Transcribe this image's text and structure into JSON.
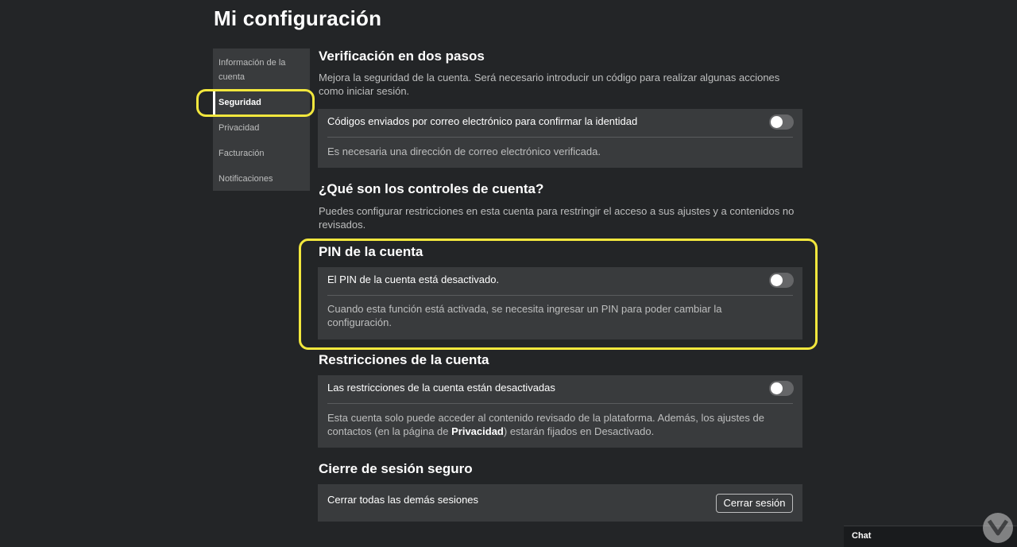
{
  "page": {
    "title": "Mi configuración"
  },
  "sidebar": {
    "items": [
      {
        "label": "Información de la cuenta",
        "active": false
      },
      {
        "label": "Seguridad",
        "active": true
      },
      {
        "label": "Privacidad",
        "active": false
      },
      {
        "label": "Facturación",
        "active": false
      },
      {
        "label": "Notificaciones",
        "active": false
      }
    ]
  },
  "two_step": {
    "title": "Verificación en dos pasos",
    "description": "Mejora la seguridad de la cuenta. Será necesario introducir un código para realizar algunas acciones como iniciar sesión.",
    "toggle_label": "Códigos enviados por correo electrónico para confirmar la identidad",
    "toggle_on": false,
    "note": "Es necesaria una dirección de correo electrónico verificada."
  },
  "account_controls": {
    "title": "¿Qué son los controles de cuenta?",
    "description": "Puedes configurar restricciones en esta cuenta para restringir el acceso a sus ajustes y a contenidos no revisados."
  },
  "account_pin": {
    "title": "PIN de la cuenta",
    "toggle_label": "El PIN de la cuenta está desactivado.",
    "toggle_on": false,
    "note": "Cuando esta función está activada, se necesita ingresar un PIN para poder cambiar la configuración."
  },
  "account_restrictions": {
    "title": "Restricciones de la cuenta",
    "toggle_label": "Las restricciones de la cuenta están desactivadas",
    "toggle_on": false,
    "note_before": "Esta cuenta solo puede acceder al contenido revisado de la plataforma. Además, los ajustes de contactos (en la página de ",
    "note_link": "Privacidad",
    "note_after": ") estarán fijados en Desactivado."
  },
  "secure_signout": {
    "title": "Cierre de sesión seguro",
    "row_label": "Cerrar todas las demás sesiones",
    "button_label": "Cerrar sesión"
  },
  "chat": {
    "label": "Chat"
  },
  "colors": {
    "background": "#232527",
    "card": "#393b3d",
    "annotation": "#f2e73d"
  }
}
